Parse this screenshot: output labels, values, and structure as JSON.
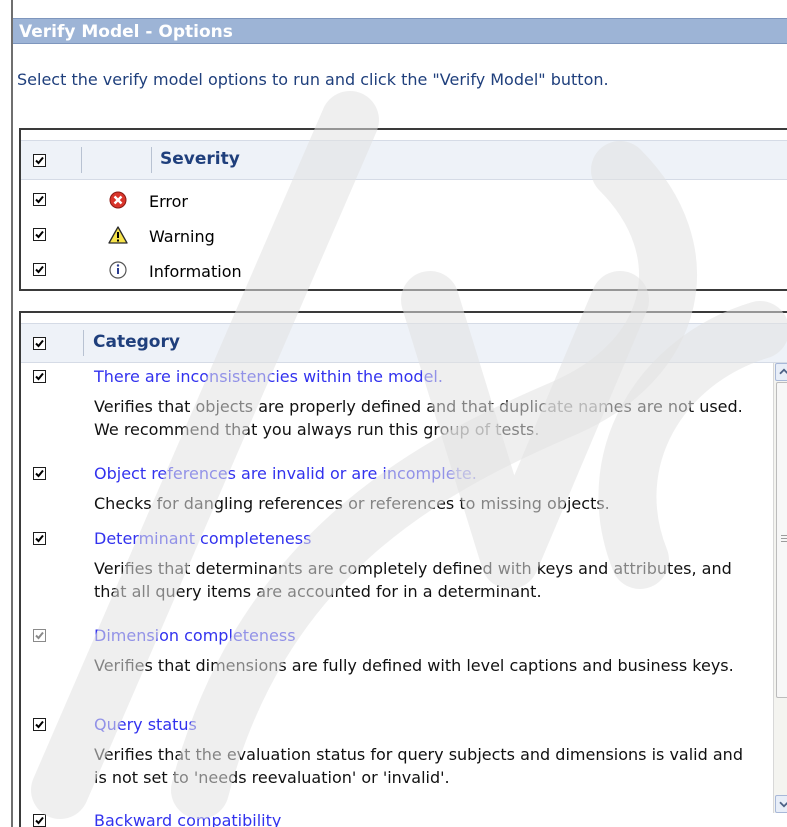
{
  "window": {
    "title": "Verify Model - Options"
  },
  "instructions": "Select the verify model options to run and click the \"Verify Model\" button.",
  "severity": {
    "header": "Severity",
    "header_checked": true,
    "rows": [
      {
        "label": "Error",
        "icon": "error-icon",
        "checked": true
      },
      {
        "label": "Warning",
        "icon": "warning-icon",
        "checked": true
      },
      {
        "label": "Information",
        "icon": "information-icon",
        "checked": true
      }
    ]
  },
  "category": {
    "header": "Category",
    "header_checked": true,
    "items": [
      {
        "title": "There are inconsistencies within the model.",
        "description": "Verifies that objects are properly defined and that duplicate names are not used. We recommend that you always run this group of tests.",
        "checked": true
      },
      {
        "title": "Object references are invalid or are incomplete.",
        "description": "Checks for dangling references or references to missing objects.",
        "checked": true
      },
      {
        "title": "Determinant completeness",
        "description": "Verifies that determinants are completely defined with keys and attributes, and that all query items are accounted for in a determinant.",
        "checked": true
      },
      {
        "title": "Dimension completeness",
        "description": "Verifies that dimensions are fully defined with level captions and business keys.",
        "checked": true
      },
      {
        "title": "Query status",
        "description": "Verifies that the evaluation status for query subjects and dimensions is valid and is not set to 'needs reevaluation' or 'invalid'.",
        "checked": true
      },
      {
        "title": "Backward compatibility",
        "description": "",
        "checked": true
      }
    ]
  },
  "colors": {
    "title_bar": "#9db4d6",
    "header_text": "#1f3f7c",
    "link_text": "#3232ee"
  }
}
